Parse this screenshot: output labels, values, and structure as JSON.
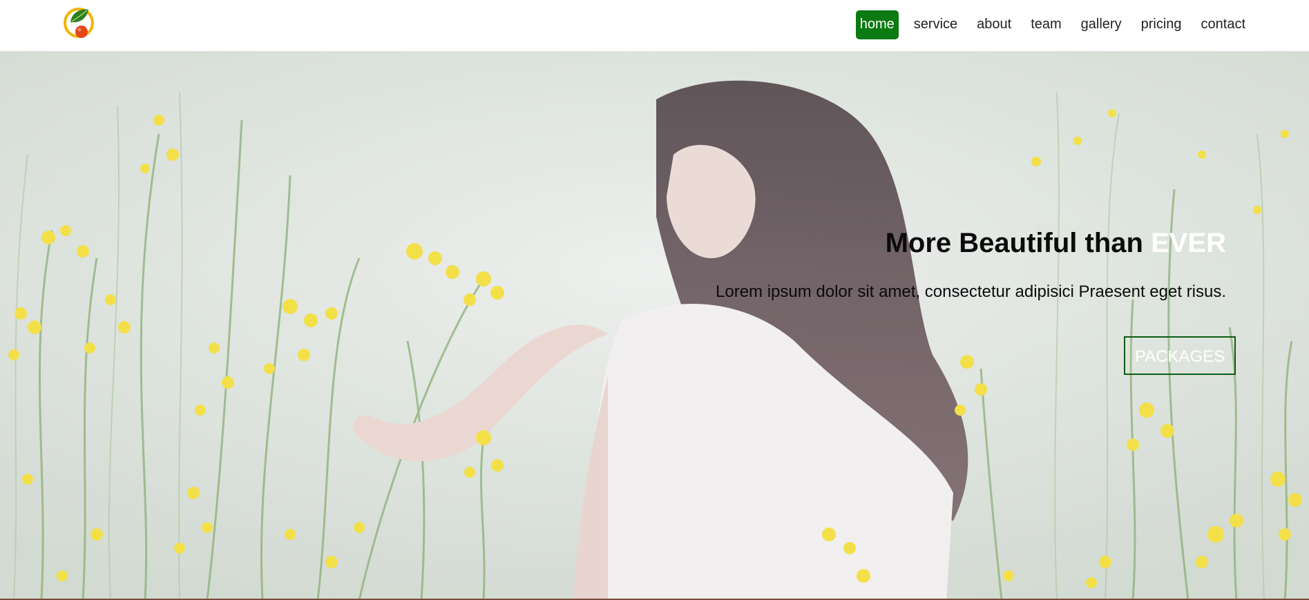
{
  "header": {
    "logo_icon": "orange-leaf-logo-icon",
    "nav": [
      {
        "label": "home",
        "active": true
      },
      {
        "label": "service",
        "active": false
      },
      {
        "label": "about",
        "active": false
      },
      {
        "label": "team",
        "active": false
      },
      {
        "label": "gallery",
        "active": false
      },
      {
        "label": "pricing",
        "active": false
      },
      {
        "label": "contact",
        "active": false
      }
    ]
  },
  "hero": {
    "title_main": "More Beautiful than ",
    "title_accent": "EVER",
    "subtitle": "Lorem ipsum dolor sit amet, consectetur adipisici Praesent eget risus.",
    "button_label": "PACKAGES"
  },
  "colors": {
    "nav_active_bg": "#0b7a12",
    "button_border": "#0b5c13",
    "flower_yellow": "#f2de3a",
    "stem_green": "#7fa86a"
  }
}
